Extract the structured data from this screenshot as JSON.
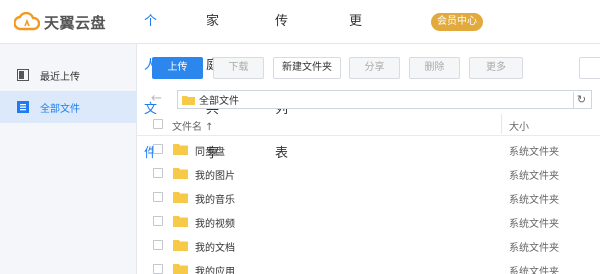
{
  "header": {
    "logo_text": "天翼云盘",
    "nav": [
      "个人文件",
      "家庭共享",
      "传输列表",
      "更多"
    ],
    "active_nav": "个人文件",
    "vip_badge": "会员中心",
    "colors": {
      "accent": "#1e7cf0",
      "vip": "#e2a93c"
    }
  },
  "sidebar": {
    "items": [
      {
        "label": "最近上传",
        "icon": "recent-upload-icon",
        "active": false
      },
      {
        "label": "全部文件",
        "icon": "all-files-icon",
        "active": true
      }
    ]
  },
  "toolbar": {
    "upload": "上传",
    "download": "下载",
    "new_folder": "新建文件夹",
    "share": "分享",
    "delete": "删除",
    "more": "更多"
  },
  "pathbar": {
    "back_icon": "back-arrow-icon",
    "path": "全部文件",
    "refresh_icon": "refresh-icon"
  },
  "list": {
    "columns": {
      "name": "文件名 ↑",
      "size": "大小"
    },
    "rows": [
      {
        "name": "同步盘",
        "type": "系统文件夹"
      },
      {
        "name": "我的图片",
        "type": "系统文件夹"
      },
      {
        "name": "我的音乐",
        "type": "系统文件夹"
      },
      {
        "name": "我的视频",
        "type": "系统文件夹"
      },
      {
        "name": "我的文档",
        "type": "系统文件夹"
      },
      {
        "name": "我的应用",
        "type": "系统文件夹"
      }
    ]
  }
}
